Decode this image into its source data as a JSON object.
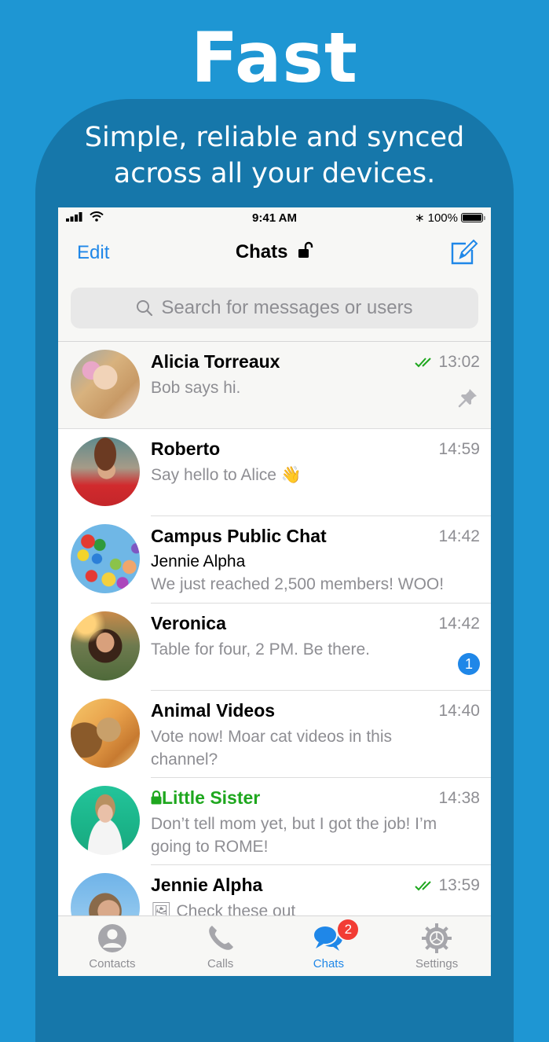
{
  "promo": {
    "headline": "Fast",
    "tagline_line1": "Simple, reliable and synced",
    "tagline_line2": "across all your devices."
  },
  "statusbar": {
    "time": "9:41 AM",
    "battery": "100%",
    "icons": [
      "signal-icon",
      "wifi-icon",
      "bluetooth-icon",
      "battery-icon"
    ]
  },
  "navbar": {
    "edit_label": "Edit",
    "title": "Chats",
    "title_icon": "unlock-icon",
    "compose_icon": "compose-icon"
  },
  "search": {
    "placeholder": "Search for messages or users"
  },
  "colors": {
    "accent": "#1f87e8",
    "secret_green": "#1ea71e",
    "badge_red": "#f23c34",
    "promo_bg": "#1e96d3",
    "panel_bg": "#1677aa"
  },
  "chats": [
    {
      "name": "Alicia Torreaux",
      "time": "13:02",
      "message": "Bob says hi.",
      "read": true,
      "pinned": true
    },
    {
      "name": "Roberto",
      "time": "14:59",
      "message": "Say hello to Alice 👋"
    },
    {
      "name": "Campus Public Chat",
      "time": "14:42",
      "sender": "Jennie Alpha",
      "message": "We just reached 2,500 members! WOO!"
    },
    {
      "name": "Veronica",
      "time": "14:42",
      "message": "Table for four, 2 PM. Be there.",
      "unread": "1"
    },
    {
      "name": "Animal Videos",
      "time": "14:40",
      "message": "Vote now! Moar cat videos in this channel?"
    },
    {
      "name": "Little Sister",
      "time": "14:38",
      "message": "Don’t tell mom yet, but I got the job! I’m going to ROME!",
      "secret": true
    },
    {
      "name": "Jennie Alpha",
      "time": "13:59",
      "message": "🖼 Check these out",
      "read": true
    }
  ],
  "tabs": [
    {
      "label": "Contacts",
      "icon": "contacts-icon"
    },
    {
      "label": "Calls",
      "icon": "phone-icon"
    },
    {
      "label": "Chats",
      "icon": "chats-icon",
      "active": true,
      "badge": "2"
    },
    {
      "label": "Settings",
      "icon": "settings-icon"
    }
  ]
}
